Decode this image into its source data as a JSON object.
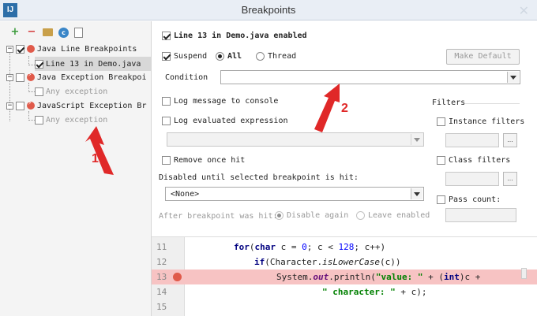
{
  "window": {
    "title": "Breakpoints",
    "app_icon": "IJ"
  },
  "left_toolbar": {
    "icons": [
      "add-icon",
      "remove-icon",
      "folder-icon",
      "class-icon",
      "document-icon"
    ]
  },
  "tree": {
    "items": [
      {
        "label": "Java Line Breakpoints",
        "checked": true
      },
      {
        "label": "Line 13 in Demo.java",
        "checked": true
      },
      {
        "label": "Java Exception Breakpoi",
        "checked": false
      },
      {
        "label": "Any exception",
        "checked": false
      },
      {
        "label": "JavaScript Exception Br",
        "checked": false
      },
      {
        "label": "Any exception",
        "checked": false
      }
    ]
  },
  "details": {
    "enabled_label": "Line 13 in Demo.java enabled",
    "suspend_label": "Suspend",
    "all_label": "All",
    "thread_label": "Thread",
    "make_default_label": "Make Default",
    "condition_label": "Condition",
    "log_message_label": "Log message to console",
    "log_expression_label": "Log evaluated expression",
    "remove_once_hit_label": "Remove once hit",
    "disabled_until_label": "Disabled until selected breakpoint is hit:",
    "none_option": "<None>",
    "after_hit_label": "After breakpoint was hit:",
    "disable_again_label": "Disable again",
    "leave_enabled_label": "Leave enabled"
  },
  "filters": {
    "heading": "Filters",
    "instance_filters_label": "Instance filters",
    "class_filters_label": "Class filters",
    "pass_count_label": "Pass count:",
    "browse_label": "..."
  },
  "code": {
    "lines": [
      {
        "num": "11"
      },
      {
        "num": "12"
      },
      {
        "num": "13"
      },
      {
        "num": "14"
      },
      {
        "num": "15"
      }
    ]
  },
  "annotations": {
    "one": "1",
    "two": "2"
  },
  "colors": {
    "annotation_red": "#e02828",
    "breakpoint_line": "#f7c3c3"
  }
}
